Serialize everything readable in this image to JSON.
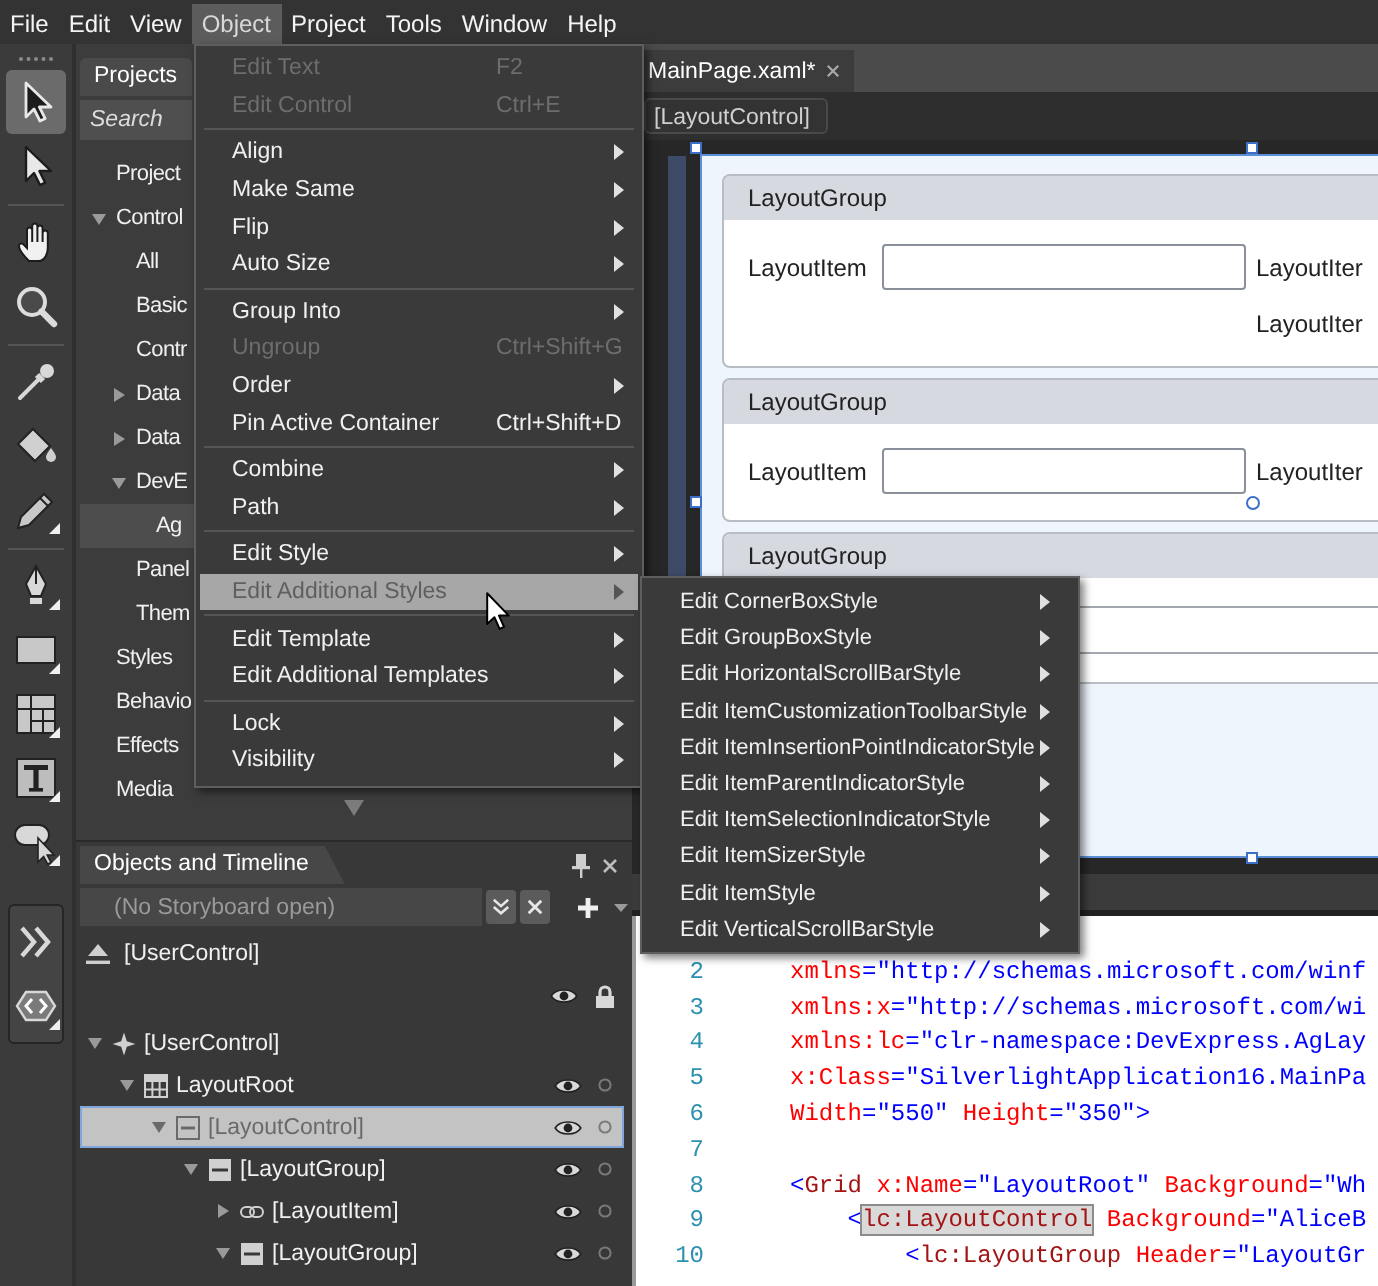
{
  "menu_bar": {
    "items": [
      {
        "label": "File",
        "selected": false
      },
      {
        "label": "Edit",
        "selected": false
      },
      {
        "label": "View",
        "selected": false
      },
      {
        "label": "Object",
        "selected": true
      },
      {
        "label": "Project",
        "selected": false
      },
      {
        "label": "Tools",
        "selected": false
      },
      {
        "label": "Window",
        "selected": false
      },
      {
        "label": "Help",
        "selected": false
      }
    ]
  },
  "toolbox": {
    "groups": [
      {
        "boxed": false,
        "tools": [
          {
            "kind": "selection",
            "selected": true,
            "flyout": false
          },
          {
            "kind": "direct-selection",
            "selected": false,
            "flyout": false
          }
        ]
      },
      {
        "boxed": false,
        "tools": [
          {
            "kind": "pan",
            "selected": false,
            "flyout": false
          },
          {
            "kind": "zoom",
            "selected": false,
            "flyout": false
          }
        ]
      },
      {
        "boxed": false,
        "tools": [
          {
            "kind": "eyedropper",
            "selected": false,
            "flyout": false
          },
          {
            "kind": "paint-bucket",
            "selected": false,
            "flyout": false
          },
          {
            "kind": "pencil",
            "selected": false,
            "flyout": true
          }
        ]
      },
      {
        "boxed": false,
        "tools": [
          {
            "kind": "pen",
            "selected": false,
            "flyout": true
          },
          {
            "kind": "rectangle",
            "selected": false,
            "flyout": true
          },
          {
            "kind": "grid",
            "selected": false,
            "flyout": true
          },
          {
            "kind": "text",
            "selected": false,
            "flyout": true
          },
          {
            "kind": "balloon",
            "selected": false,
            "flyout": true
          }
        ]
      },
      {
        "boxed": true,
        "tools": [
          {
            "kind": "chevrons",
            "selected": false,
            "flyout": false
          },
          {
            "kind": "asset",
            "selected": false,
            "flyout": true
          }
        ]
      }
    ]
  },
  "projects_panel": {
    "tab": "Projects",
    "search": {
      "placeholder": "Search"
    },
    "tree": [
      {
        "label": "Project",
        "selected": false
      },
      {
        "label": "Control",
        "expanded": true,
        "selected": false,
        "children": [
          {
            "label": "All",
            "selected": false
          },
          {
            "label": "Basic",
            "selected": false
          },
          {
            "label": "Contr",
            "selected": false
          },
          {
            "label": "Data",
            "expanded": false,
            "selected": false
          },
          {
            "label": "Data",
            "expanded": false,
            "selected": false
          },
          {
            "label": "DevE",
            "expanded": true,
            "selected": false,
            "children": [
              {
                "label": "Ag",
                "selected": true
              }
            ]
          },
          {
            "label": "Panel",
            "selected": false
          },
          {
            "label": "Them",
            "selected": false
          }
        ]
      },
      {
        "label": "Styles",
        "selected": false
      },
      {
        "label": "Behavio",
        "selected": false
      },
      {
        "label": "Effects",
        "selected": false
      },
      {
        "label": "Media",
        "selected": false
      }
    ]
  },
  "objects_panel": {
    "tab": "Objects and Timeline",
    "storyboard": {
      "value": "(No Storyboard open)"
    },
    "scope": "[UserControl]",
    "tree": [
      {
        "label": "[UserControl]",
        "kind": "user-control",
        "expanded": true,
        "selected": false,
        "children": [
          {
            "label": "LayoutRoot",
            "kind": "grid",
            "expanded": true,
            "selected": false,
            "children": [
              {
                "label": "[LayoutControl]",
                "kind": "layout-control",
                "expanded": true,
                "selected": true,
                "children": [
                  {
                    "label": "[LayoutGroup]",
                    "kind": "layout-group",
                    "expanded": true,
                    "selected": false,
                    "children": [
                      {
                        "label": "[LayoutItem]",
                        "kind": "layout-item",
                        "expanded": false,
                        "selected": false
                      },
                      {
                        "label": "[LayoutGroup]",
                        "kind": "layout-group",
                        "expanded": true,
                        "selected": false
                      }
                    ]
                  }
                ]
              }
            ]
          }
        ]
      }
    ]
  },
  "document": {
    "tab": {
      "title": "MainPage.xaml*"
    },
    "breadcrumb": "[LayoutControl]",
    "layout_groups": [
      {
        "header": "LayoutGroup",
        "rows": [
          {
            "items": [
              {
                "label": "LayoutItem",
                "kind": "text-field"
              },
              {
                "label": "LayoutIter",
                "kind": "label"
              }
            ]
          },
          {
            "items": [
              {
                "label": "LayoutIter",
                "kind": "label"
              }
            ]
          }
        ]
      },
      {
        "header": "LayoutGroup",
        "rows": [
          {
            "items": [
              {
                "label": "LayoutItem",
                "kind": "text-field"
              },
              {
                "label": "LayoutIter",
                "kind": "label"
              }
            ]
          }
        ]
      },
      {
        "header": "LayoutGroup"
      }
    ]
  },
  "code_editor": {
    "lines": [
      {
        "number": "2",
        "tokens": [
          {
            "kind": "attr",
            "text": "xmlns"
          },
          {
            "kind": "punct",
            "text": "="
          },
          {
            "kind": "value",
            "text": "\"http://schemas.microsoft.com/winf"
          }
        ]
      },
      {
        "number": "3",
        "tokens": [
          {
            "kind": "attr",
            "text": "xmlns:x"
          },
          {
            "kind": "punct",
            "text": "="
          },
          {
            "kind": "value",
            "text": "\"http://schemas.microsoft.com/wi"
          }
        ]
      },
      {
        "number": "4",
        "tokens": [
          {
            "kind": "attr",
            "text": "xmlns:lc"
          },
          {
            "kind": "punct",
            "text": "="
          },
          {
            "kind": "value",
            "text": "\"clr-namespace:DevExpress.AgLay"
          }
        ]
      },
      {
        "number": "5",
        "tokens": [
          {
            "kind": "attr",
            "text": "x:Class"
          },
          {
            "kind": "punct",
            "text": "="
          },
          {
            "kind": "value",
            "text": "\"SilverlightApplication16.MainPa"
          }
        ]
      },
      {
        "number": "6",
        "tokens": [
          {
            "kind": "attr",
            "text": "Width"
          },
          {
            "kind": "punct",
            "text": "="
          },
          {
            "kind": "value",
            "text": "\"550\""
          },
          {
            "kind": "attr",
            "text": " Height"
          },
          {
            "kind": "punct",
            "text": "="
          },
          {
            "kind": "value",
            "text": "\"350\""
          },
          {
            "kind": "punct",
            "text": ">"
          }
        ]
      },
      {
        "number": "7"
      },
      {
        "number": "8",
        "tokens": [
          {
            "kind": "punct",
            "text": "<"
          },
          {
            "kind": "element",
            "text": "Grid"
          },
          {
            "kind": "attr",
            "text": " x:Name"
          },
          {
            "kind": "punct",
            "text": "="
          },
          {
            "kind": "value",
            "text": "\"LayoutRoot\""
          },
          {
            "kind": "attr",
            "text": " Background"
          },
          {
            "kind": "punct",
            "text": "="
          },
          {
            "kind": "value",
            "text": "\"Wh"
          }
        ]
      },
      {
        "number": "9",
        "tokens": [
          {
            "kind": "punct",
            "text": "    <"
          },
          {
            "kind": "matched-element",
            "text": "lc:LayoutControl"
          },
          {
            "kind": "attr",
            "text": " Background"
          },
          {
            "kind": "punct",
            "text": "="
          },
          {
            "kind": "value",
            "text": "\"AliceB"
          }
        ]
      },
      {
        "number": "10",
        "tokens": [
          {
            "kind": "punct",
            "text": "        <"
          },
          {
            "kind": "element",
            "text": "lc:LayoutGroup"
          },
          {
            "kind": "attr",
            "text": " Header"
          },
          {
            "kind": "punct",
            "text": "="
          },
          {
            "kind": "value",
            "text": "\"LayoutGr"
          }
        ]
      }
    ]
  },
  "object_menu": {
    "sections": [
      {
        "items": [
          {
            "label": "Edit Text",
            "shortcut": "F2",
            "disabled": true,
            "has_submenu": false,
            "selected": false
          },
          {
            "label": "Edit Control",
            "shortcut": "Ctrl+E",
            "disabled": true,
            "has_submenu": false,
            "selected": false
          }
        ]
      },
      {
        "items": [
          {
            "label": "Align",
            "disabled": false,
            "has_submenu": true,
            "selected": false
          },
          {
            "label": "Make Same",
            "disabled": false,
            "has_submenu": true,
            "selected": false
          },
          {
            "label": "Flip",
            "disabled": false,
            "has_submenu": true,
            "selected": false
          },
          {
            "label": "Auto Size",
            "disabled": false,
            "has_submenu": true,
            "selected": false
          }
        ]
      },
      {
        "items": [
          {
            "label": "Group Into",
            "disabled": false,
            "has_submenu": true,
            "selected": false
          },
          {
            "label": "Ungroup",
            "shortcut": "Ctrl+Shift+G",
            "disabled": true,
            "has_submenu": false,
            "selected": false
          },
          {
            "label": "Order",
            "disabled": false,
            "has_submenu": true,
            "selected": false
          },
          {
            "label": "Pin Active Container",
            "shortcut": "Ctrl+Shift+D",
            "disabled": false,
            "has_submenu": false,
            "selected": false
          }
        ]
      },
      {
        "items": [
          {
            "label": "Combine",
            "disabled": false,
            "has_submenu": true,
            "selected": false
          },
          {
            "label": "Path",
            "disabled": false,
            "has_submenu": true,
            "selected": false
          }
        ]
      },
      {
        "items": [
          {
            "label": "Edit Style",
            "disabled": false,
            "has_submenu": true,
            "selected": false
          },
          {
            "label": "Edit Additional Styles",
            "disabled": false,
            "has_submenu": true,
            "selected": true
          }
        ]
      },
      {
        "items": [
          {
            "label": "Edit Template",
            "disabled": false,
            "has_submenu": true,
            "selected": false
          },
          {
            "label": "Edit Additional Templates",
            "disabled": false,
            "has_submenu": true,
            "selected": false
          }
        ]
      },
      {
        "items": [
          {
            "label": "Lock",
            "disabled": false,
            "has_submenu": true,
            "selected": false
          },
          {
            "label": "Visibility",
            "disabled": false,
            "has_submenu": true,
            "selected": false
          }
        ]
      }
    ]
  },
  "submenu": {
    "items": [
      {
        "label": "Edit CornerBoxStyle",
        "has_submenu": true
      },
      {
        "label": "Edit GroupBoxStyle",
        "has_submenu": true
      },
      {
        "label": "Edit HorizontalScrollBarStyle",
        "has_submenu": true
      },
      {
        "label": "Edit ItemCustomizationToolbarStyle",
        "has_submenu": true
      },
      {
        "label": "Edit ItemInsertionPointIndicatorStyle",
        "has_submenu": true
      },
      {
        "label": "Edit ItemParentIndicatorStyle",
        "has_submenu": true
      },
      {
        "label": "Edit ItemSelectionIndicatorStyle",
        "has_submenu": true
      },
      {
        "label": "Edit ItemSizerStyle",
        "has_submenu": true
      },
      {
        "label": "Edit ItemStyle",
        "has_submenu": true
      },
      {
        "label": "Edit VerticalScrollBarStyle",
        "has_submenu": true
      }
    ]
  }
}
